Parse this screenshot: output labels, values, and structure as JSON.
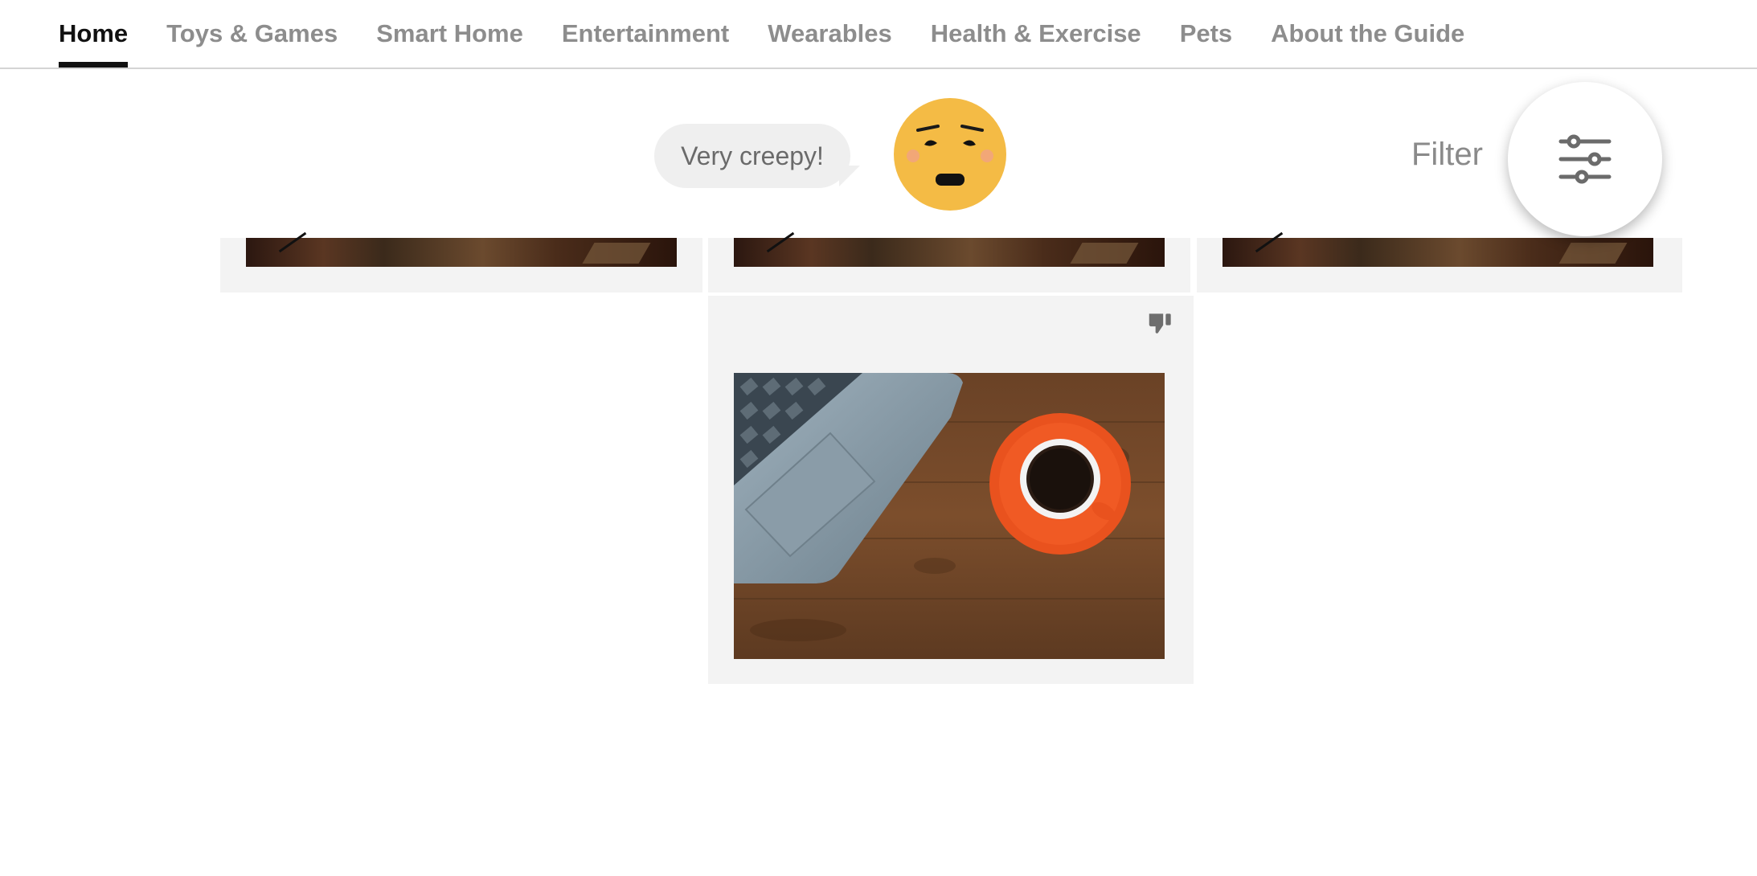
{
  "nav": {
    "items": [
      {
        "label": "Home",
        "active": true
      },
      {
        "label": "Toys & Games",
        "active": false
      },
      {
        "label": "Smart Home",
        "active": false
      },
      {
        "label": "Entertainment",
        "active": false
      },
      {
        "label": "Wearables",
        "active": false
      },
      {
        "label": "Health & Exercise",
        "active": false
      },
      {
        "label": "Pets",
        "active": false
      },
      {
        "label": "About the Guide",
        "active": false
      }
    ]
  },
  "reaction": {
    "bubble_text": "Very creepy!",
    "emoji_icon": "anxious-face-icon",
    "emoji_color": "#f4bb45"
  },
  "filter": {
    "label": "Filter",
    "icon": "sliders-icon"
  },
  "cards": {
    "top_row_count": 3,
    "featured": {
      "vote_icon": "thumbs-down-icon",
      "image": "laptop-and-coffee-cup-on-wooden-desk"
    }
  },
  "colors": {
    "active_nav": "#111111",
    "inactive_nav": "#8d8d8d",
    "card_bg": "#f3f3f3",
    "bubble_bg": "#efefef"
  }
}
